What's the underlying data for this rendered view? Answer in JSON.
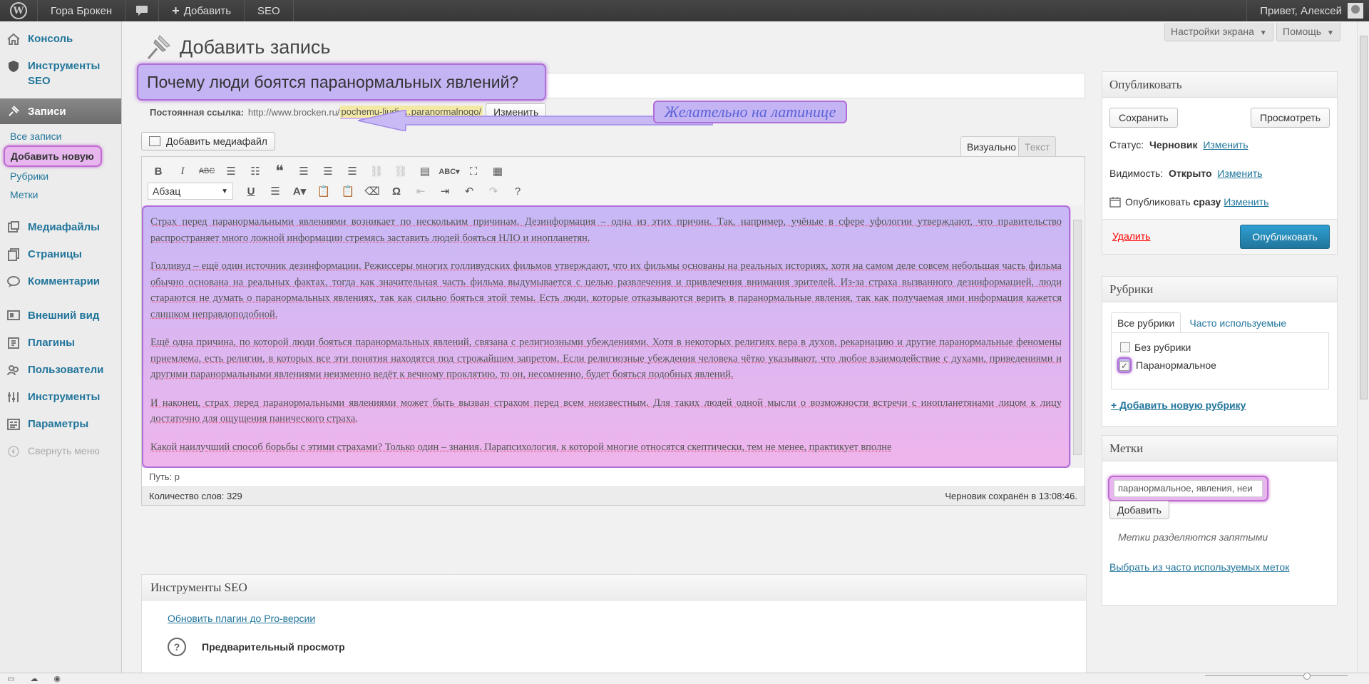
{
  "adminbar": {
    "wp_logo": "W",
    "site_name": "Гора Брокен",
    "add_label": "Добавить",
    "seo_label": "SEO",
    "greeting": "Привет, Алексей"
  },
  "sidebar": {
    "items": [
      {
        "label": "Консоль",
        "icon": "home-icon"
      },
      {
        "label": "Инструменты SEO",
        "icon": "shield-icon"
      },
      {
        "label": "Записи",
        "icon": "pin-icon"
      },
      {
        "label": "Медиафайлы",
        "icon": "media-icon"
      },
      {
        "label": "Страницы",
        "icon": "pages-icon"
      },
      {
        "label": "Комментарии",
        "icon": "comment-icon"
      },
      {
        "label": "Внешний вид",
        "icon": "appearance-icon"
      },
      {
        "label": "Плагины",
        "icon": "plugin-icon"
      },
      {
        "label": "Пользователи",
        "icon": "users-icon"
      },
      {
        "label": "Инструменты",
        "icon": "tools-icon"
      },
      {
        "label": "Параметры",
        "icon": "settings-icon"
      }
    ],
    "submenu": [
      "Все записи",
      "Добавить новую",
      "Рубрики",
      "Метки"
    ],
    "collapse": "Свернуть меню"
  },
  "header": {
    "title": "Добавить запись",
    "screen_options": "Настройки экрана",
    "help": "Помощь"
  },
  "post": {
    "title": "Почему люди боятся паранормальных явлений?",
    "permalink_label": "Постоянная ссылка:",
    "permalink_base": "http://www.brocken.ru/",
    "permalink_slug": "pochemu-ljudi-…paranormalnogo/",
    "change_button": "Изменить",
    "callout": "Желательно на латинице"
  },
  "editor": {
    "add_media": "Добавить медиафайл",
    "tab_visual": "Визуально",
    "tab_text": "Текст",
    "format": "Абзац",
    "paragraphs": [
      "Страх перед паранормальными явлениями возникает по нескольким причинам. Дезинформация – одна из этих причин. Так, например, учёные в сфере уфологии утверждают, что правительство распространяет много ложной информации стремясь заставить людей бояться НЛО и инопланетян.",
      "Голливуд – ещё один источник дезинформации. Режиссеры многих голливудских фильмов утверждают, что их фильмы основаны на реальных историях, хотя на самом деле совсем небольшая часть фильма обычно основана на реальных фактах, тогда как значительная часть фильма выдумывается с целью развлечения и привлечения внимания зрителей. Из-за страха вызванного дезинформацией, люди стараются не думать о паранормальных явлениях, так как сильно бояться этой темы. Есть люди, которые отказываются верить в паранормальные явления, так как получаемая ими информация кажется слишком неправдоподобной.",
      "Ещё одна причина, по которой люди бояться паранормальных явлений, связана с религиозными убеждениями. Хотя в некоторых религиях вера в духов, рекарнацию и другие паранормальные феномены приемлема, есть религии, в которых все эти понятия находятся под строжайшим запретом. Если религиозные убеждения человека чётко указывают, что любое взаимодействие с духами, приведениями и другими паранормальными явлениями неизменно ведёт к вечному проклятию, то он, несомненно, будет бояться подобных явлений.",
      "И наконец, страх перед паранормальными явлениями может быть вызван страхом перед всем неизвестным. Для таких людей одной мысли о возможности встречи с инопланетянами лицом к лицу достаточно для ощущения панического страха.",
      "Какой наилучший способ борьбы с этими страхами? Только один – знания. Парапсихология, к которой многие относятся скептически, тем не менее, практикует вполне"
    ],
    "path": "Путь: p",
    "word_count": "Количество слов: 329",
    "draft_saved": "Черновик сохранён в 13:08:46."
  },
  "seo_box": {
    "title": "Инструменты SEO",
    "upgrade_link": "Обновить плагин до Pro-версии",
    "preview": "Предварительный просмотр"
  },
  "publish": {
    "title": "Опубликовать",
    "save": "Сохранить",
    "preview": "Просмотреть",
    "status_label": "Статус:",
    "status_value": "Черновик",
    "visibility_label": "Видимость:",
    "visibility_value": "Открыто",
    "publish_when_label": "Опубликовать",
    "publish_when_value": "сразу",
    "edit": "Изменить",
    "delete": "Удалить",
    "publish_button": "Опубликовать"
  },
  "categories": {
    "title": "Рубрики",
    "tab_all": "Все рубрики",
    "tab_popular": "Часто используемые",
    "items": [
      {
        "label": "Без рубрики",
        "checked": false
      },
      {
        "label": "Паранормальное",
        "checked": true
      }
    ],
    "add_new": "+ Добавить новую рубрику"
  },
  "tags": {
    "title": "Метки",
    "input_value": "паранормальное, явления, неи",
    "add_button": "Добавить",
    "hint": "Метки разделяются запятыми",
    "choose_link": "Выбрать из часто используемых меток"
  }
}
